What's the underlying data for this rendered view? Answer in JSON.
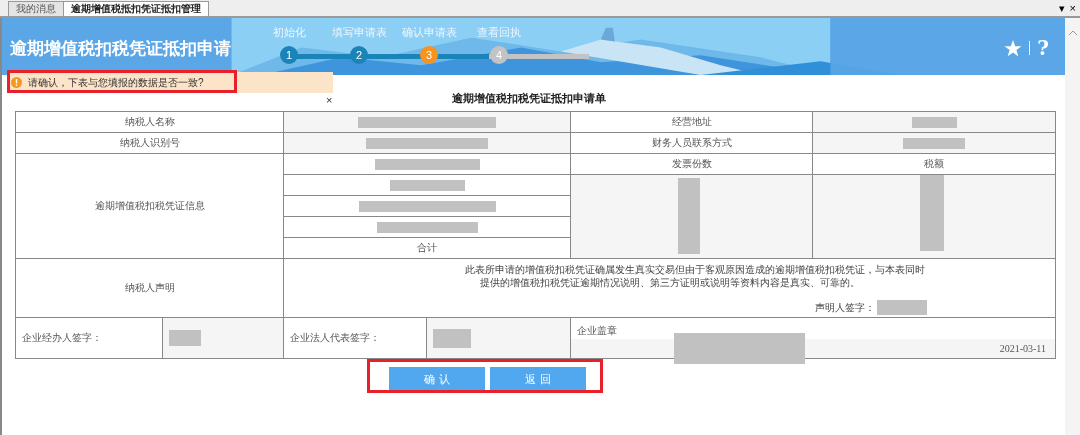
{
  "tabs": [
    {
      "label": "我的消息",
      "selected": false
    },
    {
      "label": "逾期增值税抵扣凭证抵扣管理",
      "selected": true
    }
  ],
  "window_controls": [
    "▾",
    "×"
  ],
  "header": {
    "title": "逾期增值税扣税凭证抵扣申请",
    "steps": [
      {
        "label": "初始化",
        "number": "1",
        "selected": false
      },
      {
        "label": "填写申请表",
        "number": "2",
        "selected": false
      },
      {
        "label": "确认申请表",
        "number": "3",
        "selected": true
      },
      {
        "label": "查看回执",
        "number": "4",
        "selected": false
      }
    ],
    "actions": [
      {
        "kind": "star"
      },
      {
        "kind": "help",
        "text": "?"
      }
    ]
  },
  "alert": {
    "text": "请确认，下表与您填报的数据是否一致?",
    "close": "×"
  },
  "form": {
    "title": "逾期增值税扣税凭证抵扣申请单",
    "rows": [
      {
        "label": "纳税人名称",
        "label_2": "经营地址"
      },
      {
        "label": "纳税人识别号",
        "label_2": "财务人员联系方式"
      }
    ],
    "voucher": {
      "label": "逾期增值税扣税凭证信息",
      "columns": [
        "发票份数",
        "税额"
      ],
      "total": "合计"
    },
    "declaration": {
      "label": "纳税人声明",
      "lines": [
        "此表所申请的增值税扣税凭证确属发生真实交易但由于客观原因造成的逾期增值税扣税凭证，与本表同时",
        "提供的增值税扣税凭证逾期情况说明、第三方证明或说明等资料内容是真实、可靠的。"
      ],
      "signer": "声明人签字："
    },
    "signatures": {
      "handler": "企业经办人签字：",
      "legal_rep": "企业法人代表签字：",
      "seal": "企业盖章",
      "date": "2021-03-11"
    }
  },
  "buttons": [
    "确 认",
    "返 回"
  ]
}
